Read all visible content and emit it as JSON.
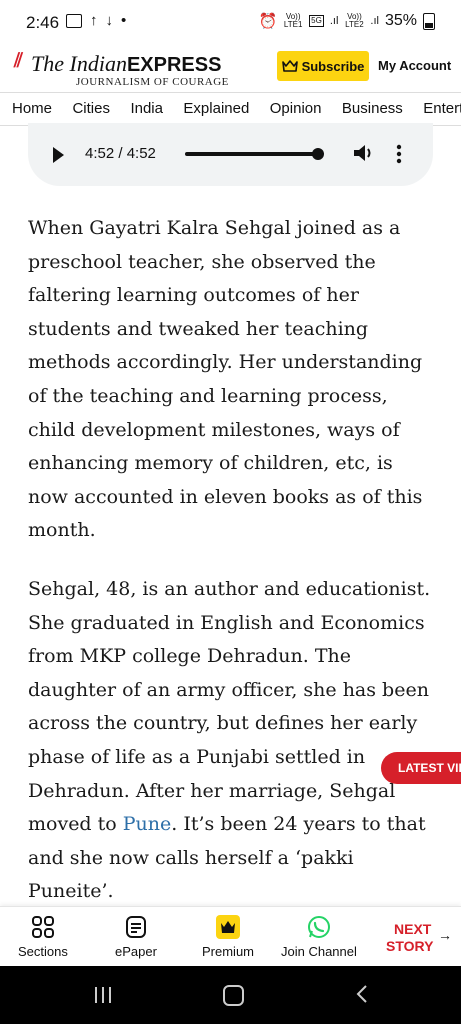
{
  "status_bar": {
    "time": "2:46",
    "net1": "Vo)) LTE1",
    "net_type": "5G",
    "net2": "Vo)) LTE2",
    "battery": "35%"
  },
  "header": {
    "logo_prefix": "The Indian",
    "logo_bold": "EXPRESS",
    "tagline": "JOURNALISM OF COURAGE",
    "subscribe_label": "Subscribe",
    "account_label": "My Account"
  },
  "nav": {
    "items": [
      "Home",
      "Cities",
      "India",
      "Explained",
      "Opinion",
      "Business",
      "Entertainment"
    ]
  },
  "audio": {
    "time": "4:52 / 4:52",
    "progress": 1.0
  },
  "article": {
    "p1": "When Gayatri Kalra Sehgal joined as a preschool teacher, she observed the faltering learning outcomes of her students and tweaked her teaching methods accordingly. Her understanding of the teaching and learning process, child development milestones, ways of enhancing memory of children, etc, is now accounted in eleven books as of this month.",
    "p2_before": "Sehgal, 48, is an author and educationist. She graduated in English and Economics from MKP college Dehradun. The daughter of an army officer, she has been across the country, but defines her early phase of life as a Punjabi settled in Dehradun. After her marriage, Sehgal moved to ",
    "p2_link": "Pune",
    "p2_after": ". It’s been 24 years to that and she now calls herself a ‘pakki Puneite’."
  },
  "latest_video": "LATEST VIDEOS",
  "bottom_bar": {
    "sections": "Sections",
    "epaper": "ePaper",
    "premium": "Premium",
    "join": "Join Channel",
    "next_line1": "NEXT",
    "next_line2": "STORY"
  },
  "colors": {
    "brand_red": "#d6202a",
    "subscribe_yellow": "#fcd411",
    "link_blue": "#2d6fa8"
  }
}
